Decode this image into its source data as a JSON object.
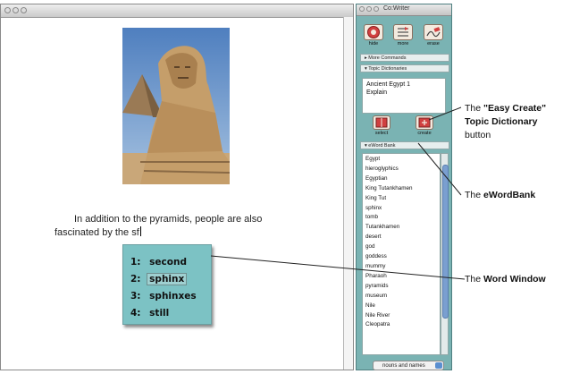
{
  "document": {
    "text_line1": "In addition to the pyramids, people are also",
    "text_line2": "fascinated by the sf",
    "word_window": [
      {
        "num": "1:",
        "word": "second"
      },
      {
        "num": "2:",
        "word": "sphinx"
      },
      {
        "num": "3:",
        "word": "sphinxes"
      },
      {
        "num": "4:",
        "word": "still"
      }
    ],
    "selected_index": 1
  },
  "panel": {
    "title": "Co:Writer",
    "buttons": [
      {
        "label": "hide",
        "icon": "hide-icon"
      },
      {
        "label": "more",
        "icon": "more-icon"
      },
      {
        "label": "erase",
        "icon": "erase-icon"
      }
    ],
    "more_commands": "More Commands",
    "topic_dictionaries": "Topic Dictionaries",
    "topic_lines": [
      "Ancient Egypt 1",
      "Explain"
    ],
    "topic_buttons": [
      {
        "label": "select",
        "icon": "select-dictionary-icon"
      },
      {
        "label": "create",
        "icon": "create-dictionary-icon"
      }
    ],
    "eword_bank": "eWord Bank",
    "bank_words": [
      "Egypt",
      "hieroglyphics",
      "Egyptian",
      "King Tutankhamen",
      "King Tut",
      "sphinx",
      "tomb",
      "Tutankhamen",
      "desert",
      "god",
      "goddess",
      "mummy",
      "Pharaoh",
      "pyramids",
      "museum",
      "Nile",
      "Nile River",
      "Cleopatra"
    ],
    "bank_select_value": "nouns and names"
  },
  "annotations": {
    "easy_create_prefix": "The ",
    "easy_create_bold": "\"Easy Create\"",
    "topic_dictionary": "Topic Dictionary",
    "button_word": "button",
    "ewordbank_prefix": "The ",
    "ewordbank_bold": "eWordBank",
    "word_window_prefix": "The ",
    "word_window_bold": "Word Window"
  },
  "colors": {
    "panel_teal": "#7ab3b3",
    "word_window_teal": "#7cc2c4",
    "scroll_blue": "#7a9fd0"
  }
}
